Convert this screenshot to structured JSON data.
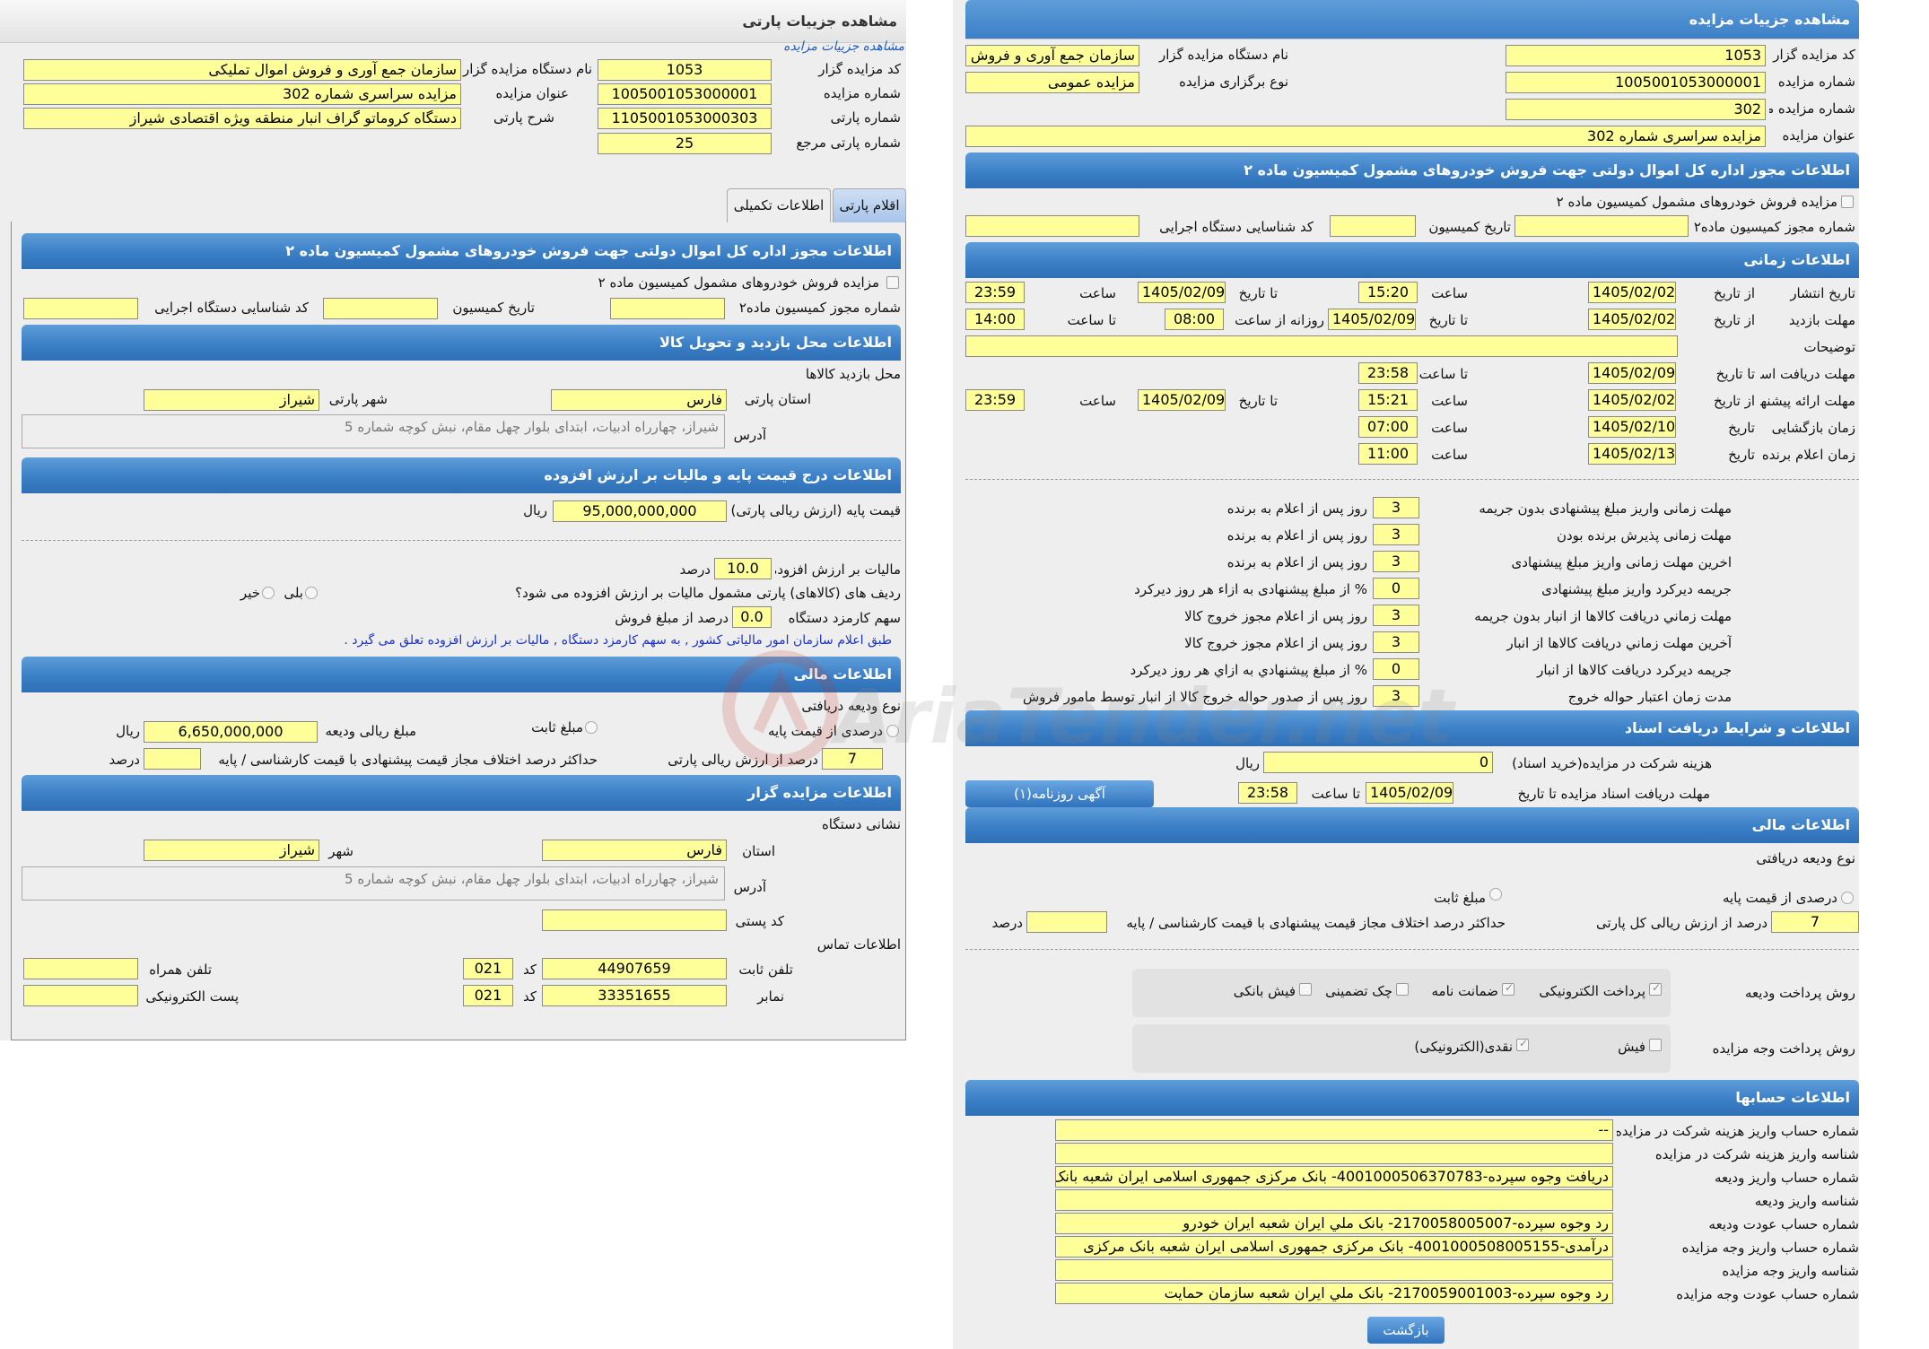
{
  "left": {
    "title": "مشاهده جزییات پارتی",
    "subtitle": "مشاهده جزییات مزایده",
    "fields": {
      "org_label": "نام دستگاه مزایده گزار",
      "org_value": "سازمان جمع آوری و فروش اموال تملیکی",
      "code_label": "کد مزایده گزار",
      "code_value": "1053",
      "title_label": "عنوان مزایده",
      "title_value": "مزایده سراسری شماره 302",
      "auction_no_label": "شماره مزایده",
      "auction_no_value": "1005001053000001",
      "desc_label": "شرح پارتی",
      "desc_value": "دستگاه کروماتو گراف انبار منطقه ویژه اقتصادی شیراز",
      "party_no_label": "شماره پارتی",
      "party_no_value": "1105001053000303",
      "party_ref_label": "شماره پارتی مرجع",
      "party_ref_value": "25"
    },
    "tabs": {
      "items": "اقلام پارتی",
      "extra": "اطلاعات تکمیلی"
    },
    "sec_permit": {
      "header": "اطلاعات مجوز اداره کل اموال دولتی جهت فروش خودروهای مشمول کمیسیون ماده ۲",
      "check_label": "مزایده فروش خودروهای مشمول کمیسیون ماده ۲",
      "permit_no_label": "شماره مجوز کمیسیون ماده۲",
      "permit_date_label": "تاریخ کمیسیون",
      "org_id_label": "کد شناسایی دستگاه اجرایی"
    },
    "sec_visit": {
      "header": "اطلاعات محل بازدید و تحویل کالا",
      "place_label": "محل بازدید کالاها",
      "province_label": "استان پارتی",
      "province_value": "فارس",
      "city_label": "شهر پارتی",
      "city_value": "شیراز",
      "address_label": "آدرس",
      "address_value": "شیراز، چهارراه ادبیات، ابتدای بلوار چهل مقام، نبش کوچه شماره 5"
    },
    "sec_price": {
      "header": "اطلاعات درج قیمت پایه و مالیات بر ارزش افزوده",
      "base_label": "قیمت پایه (ارزش ریالی پارتی)",
      "base_value": "95,000,000,000",
      "rial": "ریال",
      "vat_label": "مالیات بر ارزش افزوده",
      "vat_value": "10.0",
      "percent": "درصد",
      "vat_q": "ردیف های (کالاهای) پارتی مشمول مالیات بر ارزش افزوده می شود؟",
      "yes": "بلی",
      "no": "خیر",
      "fee_label": "سهم کارمزد دستگاه",
      "fee_value": "0.0",
      "fee_suffix": "درصد از مبلغ فروش",
      "note": "طبق اعلام سازمان امور مالیاتی کشور , به سهم کارمزد دستگاه , مالیات بر ارزش افزوده تعلق می گیرد ."
    },
    "sec_fin": {
      "header": "اطلاعات مالی",
      "type_label": "نوع ودیعه دریافتی",
      "percent_opt": "درصدی از قیمت پایه",
      "fixed_opt": "مبلغ ثابت",
      "deposit_label": "مبلغ ریالی ودیعه",
      "deposit_value": "6,650,000,000",
      "rial": "ریال",
      "pct_value": "7",
      "pct_suffix": "درصد از ارزش ریالی پارتی",
      "max_label": "حداکثر درصد اختلاف مجاز قیمت پیشنهادی با قیمت کارشناسی / پایه",
      "max_suffix": "درصد"
    },
    "sec_org": {
      "header": "اطلاعات مزایده گزار",
      "addr_title": "نشانی دستگاه",
      "province_label": "استان",
      "province_value": "فارس",
      "city_label": "شهر",
      "city_value": "شیراز",
      "address_label": "آدرس",
      "address_value": "شیراز، چهارراه ادبیات، ابتدای بلوار چهل مقام، نبش کوچه شماره 5",
      "postal_label": "کد پستی",
      "contact_title": "اطلاعات تماس",
      "phone_label": "تلفن ثابت",
      "phone_value": "44907659",
      "code_label": "کد",
      "code_value": "021",
      "mobile_label": "تلفن همراه",
      "fax_label": "نمابر",
      "fax_value": "33351655",
      "fax_code": "021",
      "email_label": "پست الکترونیکی"
    }
  },
  "right": {
    "title": "مشاهده جزییات مزایده",
    "fields": {
      "code_label": "کد مزایده گزار",
      "code_value": "1053",
      "org_label": "نام دستگاه مزایده گزار",
      "org_value": "سازمان جمع آوری و فروش",
      "auction_no_label": "شماره مزایده",
      "auction_no_value": "1005001053000001",
      "type_label": "نوع برگزاری مزایده",
      "type_value": "مزایده عمومی",
      "ref_label": "شماره مزایده مرجع",
      "ref_value": "302",
      "title_label": "عنوان مزایده",
      "title_value": "مزایده سراسری شماره 302"
    },
    "sec_permit": {
      "header": "اطلاعات مجوز اداره کل اموال دولتی جهت فروش خودروهای مشمول کمیسیون ماده ۲",
      "check_label": "مزایده فروش خودروهای مشمول کمیسیون ماده ۲",
      "permit_no_label": "شماره مجوز کمیسیون ماده۲",
      "permit_date_label": "تاریخ کمیسیون",
      "org_id_label": "کد شناسایی دستگاه اجرایی"
    },
    "sec_time": {
      "header": "اطلاعات زمانی",
      "r1": {
        "label": "تاریخ انتشار",
        "from": "از تاریخ",
        "from_v": "1405/02/02",
        "t1": "ساعت",
        "t1_v": "15:20",
        "to": "تا تاریخ",
        "to_v": "1405/02/09",
        "t2": "ساعت",
        "t2_v": "23:59"
      },
      "r2": {
        "label": "مهلت بازدید",
        "from": "از تاریخ",
        "from_v": "1405/02/02",
        "to": "تا تاریخ",
        "to_v": "1405/02/09",
        "daily": "روزانه از ساعت",
        "daily_v": "08:00",
        "till": "تا ساعت",
        "till_v": "14:00"
      },
      "desc_label": "توضیحات",
      "r3": {
        "label": "مهلت دریافت اسناد",
        "to": "تا تاریخ",
        "to_v": "1405/02/09",
        "t": "تا ساعت",
        "t_v": "23:58"
      },
      "r4": {
        "label": "مهلت ارائه پیشنهاد",
        "from": "از تاریخ",
        "from_v": "1405/02/02",
        "t1": "ساعت",
        "t1_v": "15:21",
        "to": "تا تاریخ",
        "to_v": "1405/02/09",
        "t2": "ساعت",
        "t2_v": "23:59"
      },
      "r5": {
        "label": "زمان بازگشایی",
        "d": "تاریخ",
        "d_v": "1405/02/10",
        "t": "ساعت",
        "t_v": "07:00"
      },
      "r6": {
        "label": "زمان اعلام برنده",
        "d": "تاریخ",
        "d_v": "1405/02/13",
        "t": "ساعت",
        "t_v": "11:00"
      }
    },
    "deadlines": [
      {
        "label": "مهلت زمانی واریز مبلغ پیشنهادی بدون جریمه",
        "value": "3",
        "suffix": "روز پس از اعلام به برنده"
      },
      {
        "label": "مهلت زمانی پذیرش برنده بودن",
        "value": "3",
        "suffix": "روز پس از اعلام به برنده"
      },
      {
        "label": "اخرین مهلت زمانی واریز مبلغ پیشنهادی",
        "value": "3",
        "suffix": "روز پس از اعلام به برنده"
      },
      {
        "label": "جریمه دیرکرد واریز مبلغ پیشنهادی",
        "value": "0",
        "suffix": "% از مبلغ پیشنهادی به ازاء هر روز دیرکرد"
      },
      {
        "label": "مهلت زماني دريافت كالاها از انبار بدون جريمه",
        "value": "3",
        "suffix": "روز پس از اعلام مجوز خروج كالا"
      },
      {
        "label": "آخرين مهلت زماني دريافت كالاها از انبار",
        "value": "3",
        "suffix": "روز پس از اعلام مجوز خروج كالا"
      },
      {
        "label": "جريمه ديركرد دريافت كالاها از انبار",
        "value": "0",
        "suffix": "% از مبلغ پيشنهادي به ازاي هر روز ديركرد"
      },
      {
        "label": "مدت زمان اعتبار حواله خروج",
        "value": "3",
        "suffix": "روز پس از صدور حواله خروج کالا از انبار توسط مامور فروش"
      }
    ],
    "sec_docs": {
      "header": "اطلاعات و شرایط دریافت اسناد",
      "fee_label": "هزینه شرکت در مزایده(خرید اسناد)",
      "fee_value": "0",
      "rial": "ریال",
      "deadline_label": "مهلت دریافت اسناد مزایده تا تاریخ",
      "deadline_value": "1405/02/09",
      "till": "تا ساعت",
      "till_value": "23:58",
      "news_btn": "آگهی روزنامه(۱)"
    },
    "sec_fin": {
      "header": "اطلاعات مالی",
      "type_label": "نوع ودیعه دریافتی",
      "percent_opt": "درصدی از قیمت پایه",
      "fixed_opt": "مبلغ ثابت",
      "pct_value": "7",
      "pct_suffix": "درصد از ارزش ریالی کل پارتی",
      "max_label": "حداکثر درصد اختلاف مجاز قیمت پیشنهادی با قیمت کارشناسی / پایه",
      "max_suffix": "درصد",
      "pay_label": "روش پرداخت ودیعه",
      "pay_opts": [
        "پرداخت الکترونیکی",
        "ضمانت نامه",
        "چک تضمینی",
        "فیش بانکی"
      ],
      "auction_pay_label": "روش پرداخت وجه مزایده",
      "auction_pay_opts": [
        "فیش",
        "نقدی(الکترونیکی)"
      ]
    },
    "sec_acc": {
      "header": "اطلاعات حسابها",
      "rows": [
        {
          "label": "شماره حساب واریز هزینه شرکت در مزایده",
          "value": "--"
        },
        {
          "label": "شناسه واریز هزینه شرکت در مزایده",
          "value": ""
        },
        {
          "label": "شماره حساب واریز ودیعه",
          "value": "دریافت وجوه سپرده-4001000506370783- بانک مرکزی جمهوری اسلامی ایران شعبه بانک"
        },
        {
          "label": "شناسه واریز ودیعه",
          "value": ""
        },
        {
          "label": "شماره حساب عودت ودیعه",
          "value": "رد وجوه سپرده-2170058005007- بانک ملي ايران شعبه ايران خودرو"
        },
        {
          "label": "شماره حساب واریز وجه مزایده",
          "value": "درآمدی-4001000508005155- بانک مرکزی جمهوری اسلامی ایران شعبه بانک مرکزی"
        },
        {
          "label": "شناسه واریز وجه مزایده",
          "value": ""
        },
        {
          "label": "شماره حساب عودت وجه مزایده",
          "value": "رد وجوه سپرده-2170059001003- بانک ملي ايران شعبه سازمان حمايت"
        }
      ],
      "back_btn": "بازگشت"
    }
  },
  "watermark": "AriaTender.net"
}
